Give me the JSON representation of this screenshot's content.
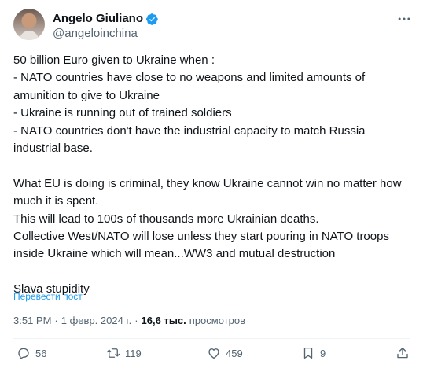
{
  "author": {
    "name": "Angelo Giuliano",
    "handle": "@angeloinchina"
  },
  "tweet": {
    "text": "50 billion Euro given to Ukraine when :\n- NATO countries have close to no weapons and limited amounts of amunition to give to Ukraine\n- Ukraine is running out of trained soldiers\n- NATO countries don't have the industrial capacity to match Russia industrial base.\n\nWhat EU is doing is criminal, they know Ukraine cannot win no matter how much it is spent.\nThis will lead to 100s of thousands more Ukrainian deaths.\nCollective West/NATO  will lose unless they start pouring in NATO troops inside Ukraine which will mean...WW3 and mutual destruction\n\nSlava stupidity",
    "translate_label": "Перевести пост"
  },
  "meta": {
    "time": "3:51 PM",
    "separator": "·",
    "date": "1 февр. 2024 г.",
    "views_count": "16,6 тыс.",
    "views_label": "просмотров"
  },
  "actions": {
    "replies": "56",
    "retweets": "119",
    "likes": "459",
    "bookmarks": "9"
  },
  "icons": [
    "verified-badge-icon",
    "more-icon",
    "reply-icon",
    "retweet-icon",
    "like-icon",
    "bookmark-icon",
    "share-icon"
  ],
  "colors": {
    "accent": "#1d9bf0",
    "secondary_text": "#536471",
    "primary_text": "#0f1419"
  }
}
